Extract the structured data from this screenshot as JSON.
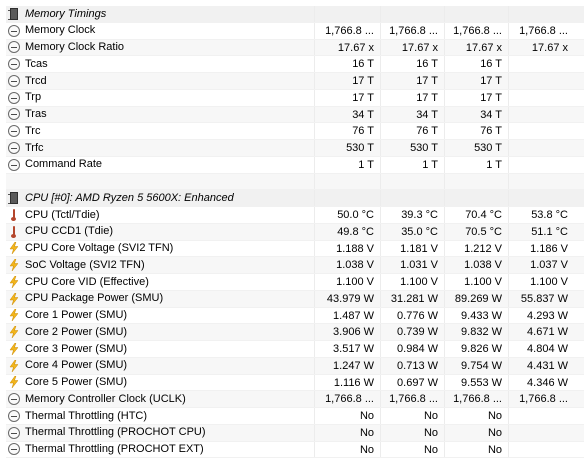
{
  "sections": [
    {
      "header": "Memory Timings",
      "rows": [
        {
          "icon": "clock",
          "name": "Memory Clock",
          "v": [
            "1,766.8 ...",
            "1,766.8 ...",
            "1,766.8 ...",
            "1,766.8 ..."
          ]
        },
        {
          "icon": "clock",
          "name": "Memory Clock Ratio",
          "v": [
            "17.67 x",
            "17.67 x",
            "17.67 x",
            "17.67 x"
          ]
        },
        {
          "icon": "clock",
          "name": "Tcas",
          "v": [
            "16 T",
            "16 T",
            "16 T",
            ""
          ]
        },
        {
          "icon": "clock",
          "name": "Trcd",
          "v": [
            "17 T",
            "17 T",
            "17 T",
            ""
          ]
        },
        {
          "icon": "clock",
          "name": "Trp",
          "v": [
            "17 T",
            "17 T",
            "17 T",
            ""
          ]
        },
        {
          "icon": "clock",
          "name": "Tras",
          "v": [
            "34 T",
            "34 T",
            "34 T",
            ""
          ]
        },
        {
          "icon": "clock",
          "name": "Trc",
          "v": [
            "76 T",
            "76 T",
            "76 T",
            ""
          ]
        },
        {
          "icon": "clock",
          "name": "Trfc",
          "v": [
            "530 T",
            "530 T",
            "530 T",
            ""
          ]
        },
        {
          "icon": "clock",
          "name": "Command Rate",
          "v": [
            "1 T",
            "1 T",
            "1 T",
            ""
          ]
        }
      ]
    },
    {
      "header": "CPU [#0]: AMD Ryzen 5 5600X: Enhanced",
      "rows": [
        {
          "icon": "therm",
          "name": "CPU (Tctl/Tdie)",
          "v": [
            "50.0 °C",
            "39.3 °C",
            "70.4 °C",
            "53.8 °C"
          ]
        },
        {
          "icon": "therm",
          "name": "CPU CCD1 (Tdie)",
          "v": [
            "49.8 °C",
            "35.0 °C",
            "70.5 °C",
            "51.1 °C"
          ]
        },
        {
          "icon": "bolt",
          "name": "CPU Core Voltage (SVI2 TFN)",
          "v": [
            "1.188 V",
            "1.181 V",
            "1.212 V",
            "1.186 V"
          ]
        },
        {
          "icon": "bolt",
          "name": "SoC Voltage (SVI2 TFN)",
          "v": [
            "1.038 V",
            "1.031 V",
            "1.038 V",
            "1.037 V"
          ]
        },
        {
          "icon": "bolt",
          "name": "CPU Core VID (Effective)",
          "v": [
            "1.100 V",
            "1.100 V",
            "1.100 V",
            "1.100 V"
          ]
        },
        {
          "icon": "bolt",
          "name": "CPU Package Power (SMU)",
          "v": [
            "43.979 W",
            "31.281 W",
            "89.269 W",
            "55.837 W"
          ]
        },
        {
          "icon": "bolt",
          "name": "Core 1 Power (SMU)",
          "v": [
            "1.487 W",
            "0.776 W",
            "9.433 W",
            "4.293 W"
          ]
        },
        {
          "icon": "bolt",
          "name": "Core 2 Power (SMU)",
          "v": [
            "3.906 W",
            "0.739 W",
            "9.832 W",
            "4.671 W"
          ]
        },
        {
          "icon": "bolt",
          "name": "Core 3 Power (SMU)",
          "v": [
            "3.517 W",
            "0.984 W",
            "9.826 W",
            "4.804 W"
          ]
        },
        {
          "icon": "bolt",
          "name": "Core 4 Power (SMU)",
          "v": [
            "1.247 W",
            "0.713 W",
            "9.754 W",
            "4.431 W"
          ]
        },
        {
          "icon": "bolt",
          "name": "Core 5 Power (SMU)",
          "v": [
            "1.116 W",
            "0.697 W",
            "9.553 W",
            "4.346 W"
          ]
        },
        {
          "icon": "clock",
          "name": "Memory Controller Clock (UCLK)",
          "v": [
            "1,766.8 ...",
            "1,766.8 ...",
            "1,766.8 ...",
            "1,766.8 ..."
          ]
        },
        {
          "icon": "clock",
          "name": "Thermal Throttling (HTC)",
          "v": [
            "No",
            "No",
            "No",
            ""
          ]
        },
        {
          "icon": "clock",
          "name": "Thermal Throttling (PROCHOT CPU)",
          "v": [
            "No",
            "No",
            "No",
            ""
          ]
        },
        {
          "icon": "clock",
          "name": "Thermal Throttling (PROCHOT EXT)",
          "v": [
            "No",
            "No",
            "No",
            ""
          ]
        }
      ]
    }
  ]
}
